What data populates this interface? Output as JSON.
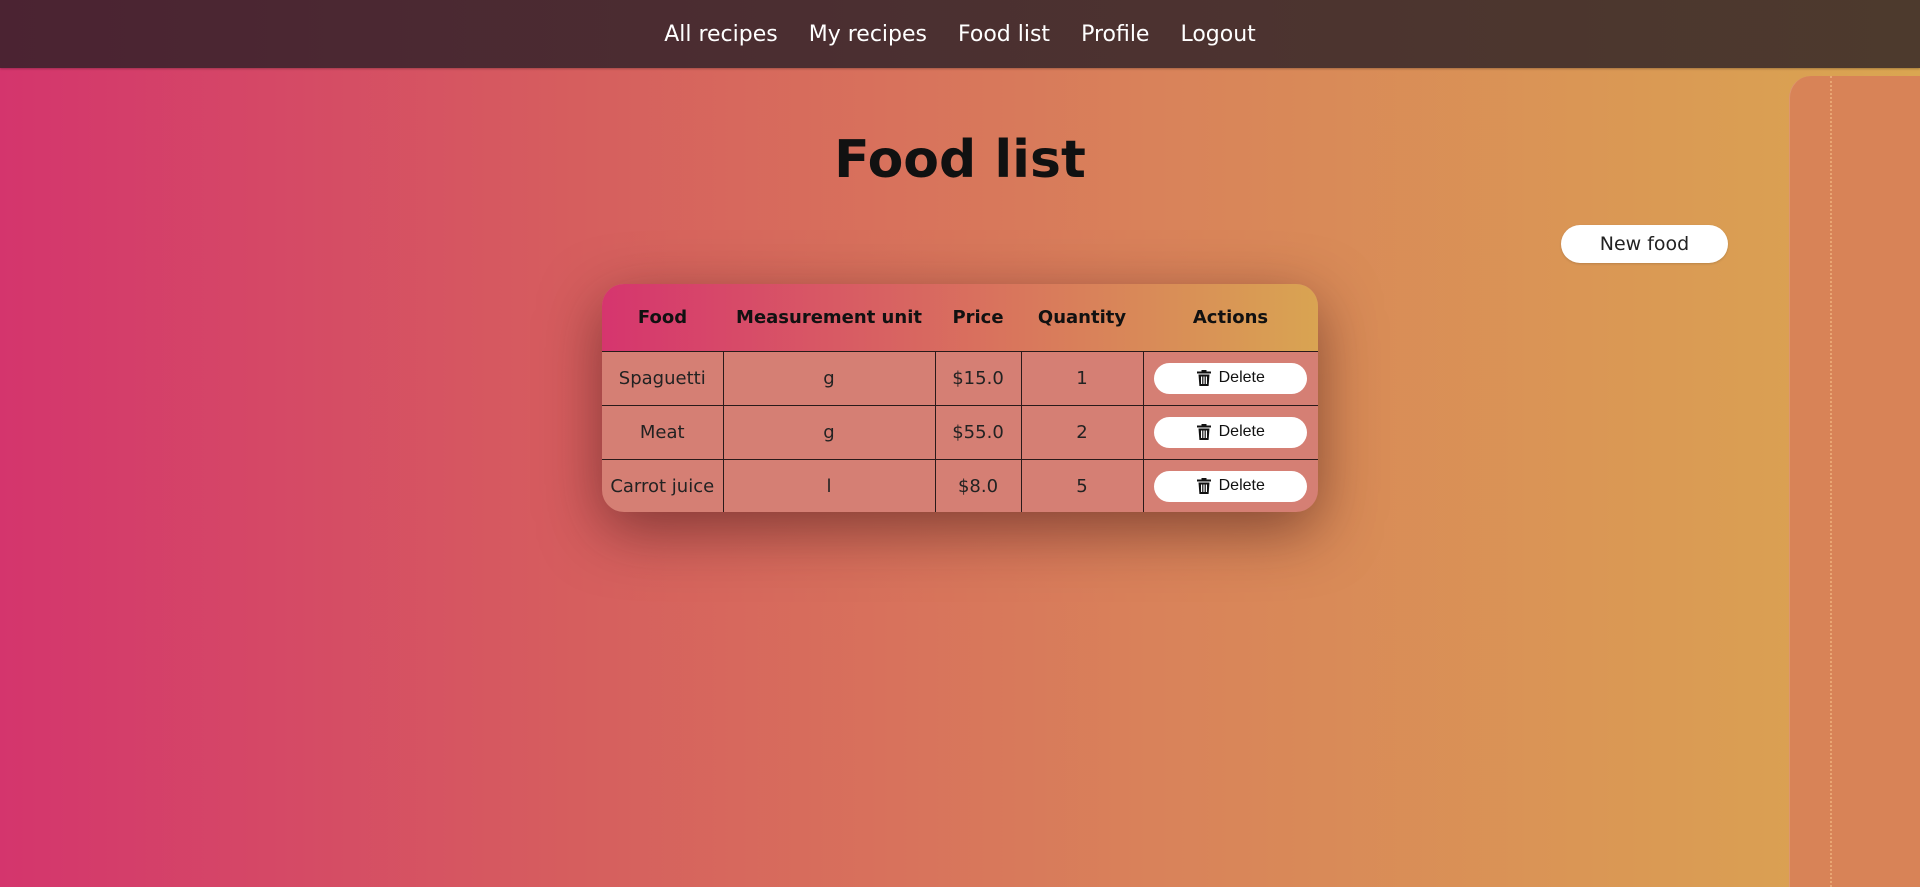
{
  "nav": {
    "items": [
      {
        "label": "All recipes"
      },
      {
        "label": "My recipes"
      },
      {
        "label": "Food list"
      },
      {
        "label": "Profile"
      },
      {
        "label": "Logout"
      }
    ]
  },
  "page": {
    "title": "Food list",
    "new_food_label": "New food"
  },
  "table": {
    "headers": [
      "Food",
      "Measurement unit",
      "Price",
      "Quantity",
      "Actions"
    ],
    "rows": [
      {
        "food": "Spaguetti",
        "unit": "g",
        "price": "$15.0",
        "quantity": "1",
        "action_label": "Delete"
      },
      {
        "food": "Meat",
        "unit": "g",
        "price": "$55.0",
        "quantity": "2",
        "action_label": "Delete"
      },
      {
        "food": "Carrot juice",
        "unit": "l",
        "price": "$8.0",
        "quantity": "5",
        "action_label": "Delete"
      }
    ],
    "action_icon": "trash-icon"
  },
  "colors": {
    "nav_bg": "#4b2c31",
    "gradient_start": "#d4356d",
    "gradient_end": "#daa651",
    "button_bg": "#ffffff"
  }
}
